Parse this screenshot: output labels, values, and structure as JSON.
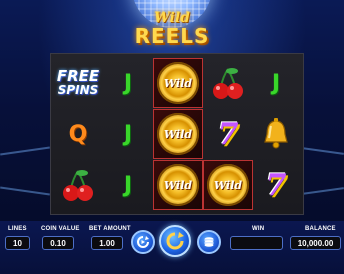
{
  "game": {
    "title_top": "Wild",
    "title_bottom": "REELS"
  },
  "reels": {
    "free_spins_top": "FREE",
    "free_spins_bottom": "SPINS",
    "letter_j": "J",
    "letter_q": "Q",
    "seven": "7",
    "wild": "Wild"
  },
  "controls": {
    "lines_label": "LINES",
    "lines_value": "10",
    "coin_value_label": "COIN VALUE",
    "coin_value_value": "0.10",
    "bet_amount_label": "BET AMOUNT",
    "bet_amount_value": "1.00",
    "win_label": "WIN",
    "win_value": "",
    "balance_label": "BALANCE",
    "balance_value": "10,000.00"
  },
  "icons": {
    "autoplay": "autoplay-icon",
    "spin": "spin-icon",
    "max_bet": "coin-stack-icon"
  },
  "colors": {
    "background": "#07103a",
    "logo_gold": "#ffd84a",
    "accent_blue": "#1e66e6",
    "j_green": "#39d62a",
    "q_orange": "#ff8a1c",
    "seven_purple": "#c455ff"
  }
}
